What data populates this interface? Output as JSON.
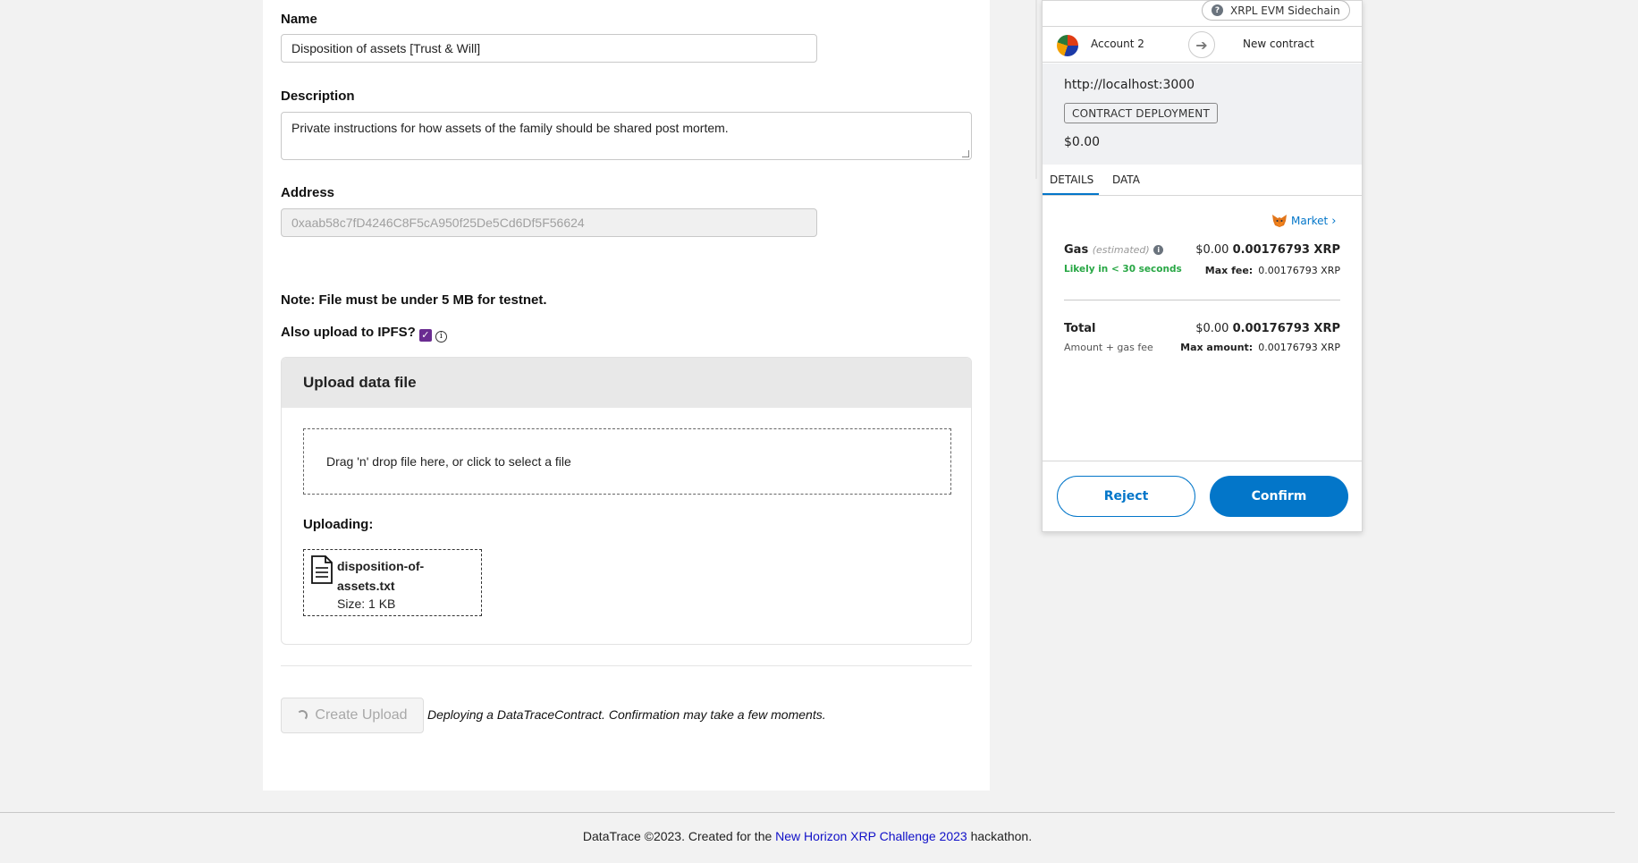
{
  "form": {
    "name_label": "Name",
    "name_value": "Disposition of assets [Trust & Will]",
    "description_label": "Description",
    "description_value": "Private instructions for how assets of the family should be shared post mortem.",
    "address_label": "Address",
    "address_value": "0xaab58c7fD4246C8F5cA950f25De5Cd6Df5F56624",
    "note": "Note: File must be under 5 MB for testnet.",
    "ipfs_label": "Also upload to IPFS?",
    "ipfs_checked": true
  },
  "upload": {
    "title": "Upload data file",
    "dropzone_text": "Drag 'n' drop file here, or click to select a file",
    "uploading_label": "Uploading:",
    "file_name": "disposition-of-assets.txt",
    "file_size": "Size: 1 KB"
  },
  "actions": {
    "create_upload_label": "Create Upload",
    "deploy_message": "Deploying a DataTraceContract. Confirmation may take a few moments."
  },
  "footer": {
    "prefix": "DataTrace ©2023. Created for the ",
    "link_text": "New Horizon XRP Challenge 2023",
    "suffix": " hackathon."
  },
  "wallet": {
    "network": "XRPL EVM Sidechain",
    "account": "Account 2",
    "destination": "New contract",
    "origin": "http://localhost:3000",
    "badge": "CONTRACT DEPLOYMENT",
    "amount": "$0.00",
    "tabs": [
      "DETAILS",
      "DATA"
    ],
    "market": "Market",
    "gas": {
      "label": "Gas",
      "estimated": "(estimated)",
      "fiat": "$0.00",
      "crypto": "0.00176793 XRP",
      "likely": "Likely in < 30 seconds",
      "max_fee_label": "Max fee:",
      "max_fee_value": "0.00176793 XRP"
    },
    "total": {
      "label": "Total",
      "sub": "Amount + gas fee",
      "fiat": "$0.00",
      "crypto": "0.00176793 XRP",
      "max_amount_label": "Max amount:",
      "max_amount_value": "0.00176793 XRP"
    },
    "reject_label": "Reject",
    "confirm_label": "Confirm"
  },
  "colors": {
    "accent": "#0376c9",
    "ipfs_check": "#6a2c91",
    "likely_green": "#28a745",
    "footer_link": "#1010c8"
  }
}
